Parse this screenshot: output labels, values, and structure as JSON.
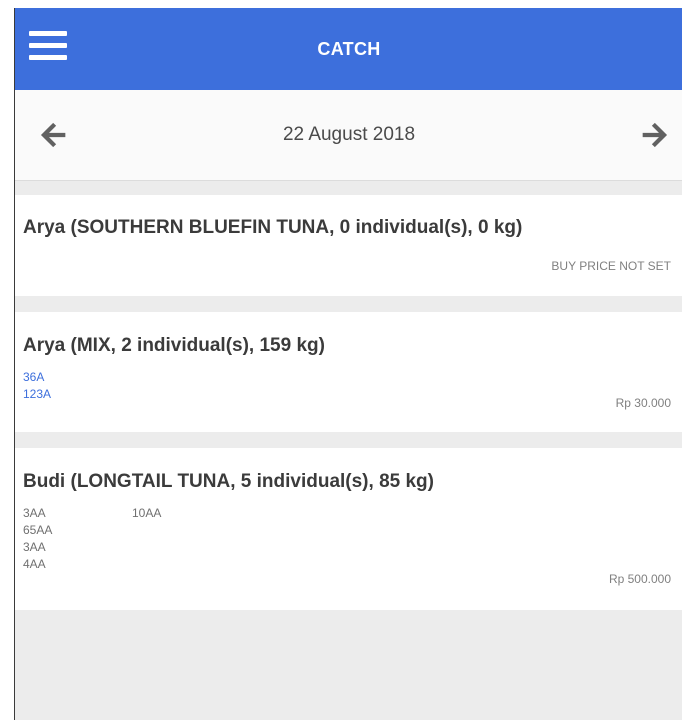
{
  "app": {
    "title": "CATCH"
  },
  "date_nav": {
    "date": "22 August 2018"
  },
  "entries": [
    {
      "title": "Arya (SOUTHERN BLUEFIN TUNA, 0 individual(s), 0 kg)",
      "price": "BUY PRICE NOT SET",
      "codes": []
    },
    {
      "title": "Arya (MIX, 2 individual(s), 159 kg)",
      "price": "Rp 30.000",
      "codes": [
        "36A",
        "123A"
      ]
    },
    {
      "title": "Budi (LONGTAIL TUNA, 5 individual(s), 85 kg)",
      "price": "Rp 500.000",
      "codes": [
        "3AA",
        "10AA",
        "65AA",
        "3AA",
        "4AA"
      ]
    }
  ],
  "colors": {
    "primary": "#3d6fdc",
    "background": "#ececec",
    "card": "#ffffff",
    "link": "#3d6fdc"
  },
  "icons": {
    "menu": "hamburger-menu-icon",
    "prev": "arrow-left-icon",
    "next": "arrow-right-icon"
  }
}
